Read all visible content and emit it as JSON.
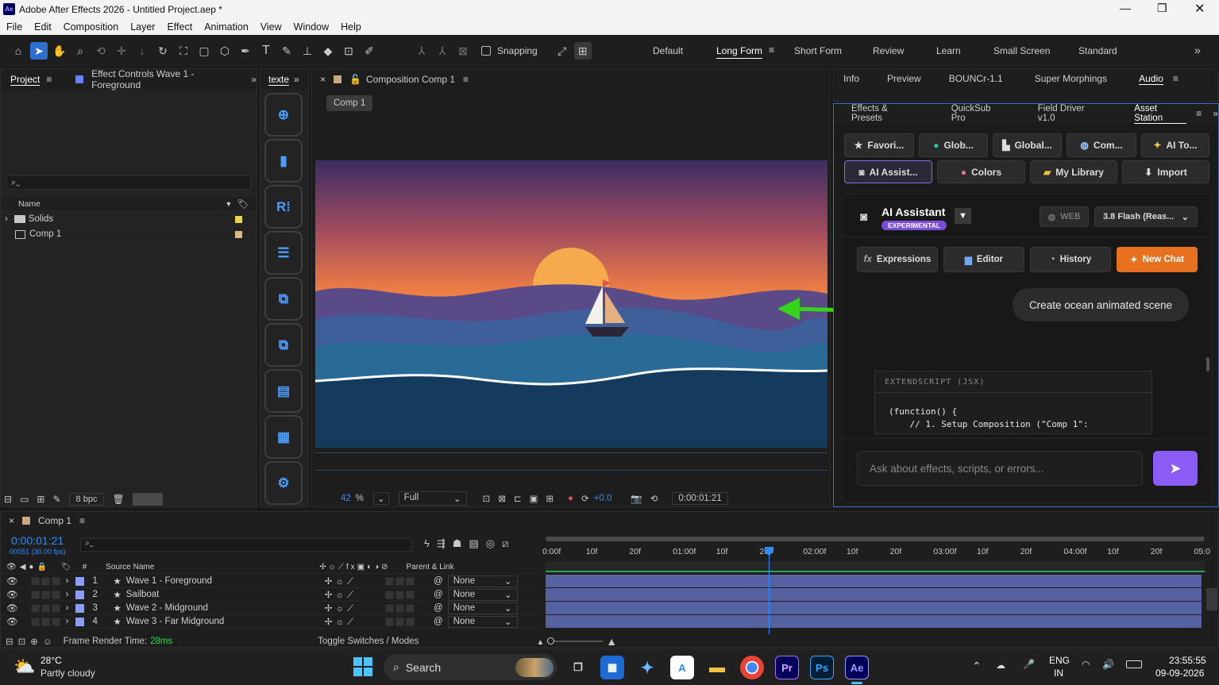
{
  "window": {
    "title": "Adobe After Effects 2026 - Untitled Project.aep *",
    "app_badge": "Ae"
  },
  "menu": [
    "File",
    "Edit",
    "Composition",
    "Layer",
    "Effect",
    "Animation",
    "View",
    "Window",
    "Help"
  ],
  "toolbar": {
    "snapping_label": "Snapping",
    "workspaces": [
      "Default",
      "Long Form",
      "Short Form",
      "Review",
      "Learn",
      "Small Screen",
      "Standard"
    ],
    "active_workspace": "Long Form"
  },
  "project_panel": {
    "tabs": [
      "Project",
      "Effect Controls Wave 1 - Foreground"
    ],
    "search_placeholder": "",
    "col_name": "Name",
    "items": [
      {
        "name": "Solids",
        "type": "folder"
      },
      {
        "name": "Comp 1",
        "type": "comp"
      }
    ],
    "bpc": "8 bpc"
  },
  "text_panel": {
    "tab": "texte"
  },
  "composition": {
    "tab": "Composition Comp 1",
    "chip": "Comp 1",
    "zoom": "42",
    "zoom_unit": "%",
    "resolution": "Full",
    "exposure": "+0.0",
    "timecode": "0:00:01:21"
  },
  "right_top": {
    "tabs": [
      "Info",
      "Preview",
      "BOUNCr-1.1",
      "Super Morphings",
      "Audio"
    ],
    "active": "Audio"
  },
  "right_second": {
    "tabs": [
      "Effects & Presets",
      "QuickSub Pro",
      "Field Driver v1.0",
      "Asset Station"
    ],
    "active": "Asset Station"
  },
  "asset_station": {
    "row1": [
      "Favori...",
      "Glob...",
      "Global...",
      "Com...",
      "AI To..."
    ],
    "row2": [
      "AI Assist...",
      "Colors",
      "My Library",
      "Import"
    ],
    "assistant": {
      "title": "AI Assistant",
      "badge": "EXPERIMENTAL",
      "web": "WEB",
      "model": "3.8 Flash (Reas...",
      "actions": [
        "Expressions",
        "Editor",
        "History",
        "New Chat"
      ]
    },
    "chat_message": "Create ocean animated scene",
    "code_header": "EXTENDSCRIPT (JSX)",
    "code_line1": "(function() {",
    "code_line2": "    // 1. Setup Composition (\"Comp 1\":",
    "input_placeholder": "Ask about effects, scripts, or errors..."
  },
  "timeline": {
    "tab": "Comp 1",
    "timecode": "0:00:01:21",
    "frames": "00051 (30.00 fps)",
    "cols": {
      "source": "Source Name",
      "parent": "Parent & Link"
    },
    "ruler": [
      "0:00f",
      "10f",
      "20f",
      "01:00f",
      "10f",
      "20f",
      "02:00f",
      "10f",
      "20f",
      "03:00f",
      "10f",
      "20f",
      "04:00f",
      "10f",
      "20f",
      "05:0"
    ],
    "layers": [
      {
        "num": "1",
        "name": "Wave 1 - Foreground",
        "parent": "None"
      },
      {
        "num": "2",
        "name": "Sailboat",
        "parent": "None"
      },
      {
        "num": "3",
        "name": "Wave 2 - Midground",
        "parent": "None"
      },
      {
        "num": "4",
        "name": "Wave 3 - Far Midground",
        "parent": "None"
      }
    ],
    "render_label": "Frame Render Time:",
    "render_value": "28ms",
    "toggle_label": "Toggle Switches / Modes"
  },
  "taskbar": {
    "temp": "28°C",
    "weather": "Partly cloudy",
    "search": "Search",
    "lang1": "ENG",
    "lang2": "IN",
    "time": "23:55:55",
    "date": "09-09-2026"
  },
  "colors": {
    "accent": "#2d8cff",
    "orange": "#e8711f",
    "purple": "#7b4ddb",
    "green_arrow": "#35d41a"
  }
}
